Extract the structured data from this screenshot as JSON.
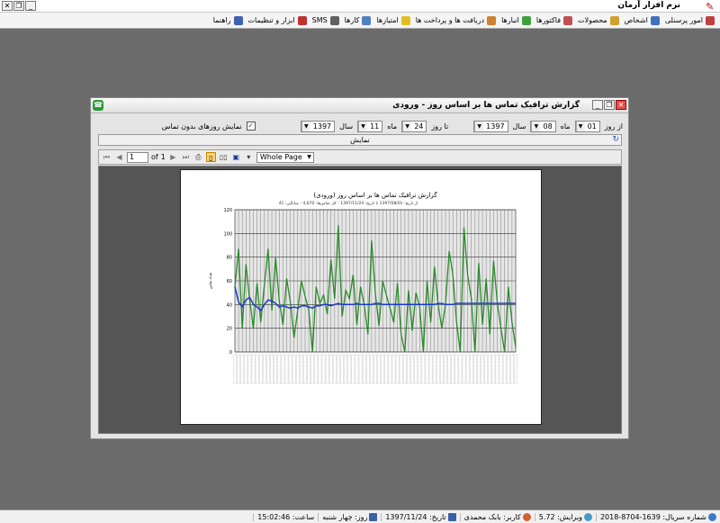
{
  "app": {
    "title": "نرم افزار آرمان"
  },
  "menu": [
    {
      "label": "امور پرسنلی",
      "icon": "personnel-icon",
      "color": "#c04040"
    },
    {
      "label": "اشخاص",
      "icon": "persons-icon",
      "color": "#4070c0"
    },
    {
      "label": "محصولات",
      "icon": "products-icon",
      "color": "#d0a030"
    },
    {
      "label": "فاکتورها",
      "icon": "invoices-icon",
      "color": "#c05050"
    },
    {
      "label": "انبارها",
      "icon": "warehouse-icon",
      "color": "#40a040"
    },
    {
      "label": "دریافت ها و پرداخت ها",
      "icon": "payments-icon",
      "color": "#d08030"
    },
    {
      "label": "امتیازها",
      "icon": "points-icon",
      "color": "#e0c020"
    },
    {
      "label": "کارها",
      "icon": "tasks-icon",
      "color": "#5080c0"
    },
    {
      "label": "SMS",
      "icon": "sms-icon",
      "color": "#606060"
    },
    {
      "label": "ابزار و تنظیمات",
      "icon": "tools-icon",
      "color": "#c03030"
    },
    {
      "label": "راهنما",
      "icon": "help-icon",
      "color": "#4060b0"
    }
  ],
  "window": {
    "title": "گزارش ترافیک تماس ها بر اساس روز - ورودی",
    "filters": {
      "from_label": "از روز",
      "from_day": "01",
      "month_label": "ماه",
      "from_month": "08",
      "year_label": "سال",
      "from_year": "1397",
      "to_label": "تا روز",
      "to_day": "24",
      "to_month": "11",
      "to_year": "1397",
      "show_empty_days_label": "نمایش روزهای بدون تماس",
      "show_empty_days_checked": "✓"
    },
    "show_button": "نمایش",
    "toolbar": {
      "page_value": "1",
      "of_label": "of",
      "total_pages": "1",
      "zoom": "Whole Page"
    }
  },
  "chart_data": {
    "type": "line",
    "title": "گزارش ترافیک تماس ها بر اساس روز (ورودی)",
    "subtitle": "از تاریخ: 1397/08/01 تا تاریخ: 1397/11/24 - کل تماس‌ها: 4,670 - میانگین: 41",
    "ylabel": "تعداد تماس",
    "ylim": [
      0,
      120
    ],
    "yticks": [
      0,
      20,
      40,
      60,
      80,
      100,
      120
    ],
    "grid": true,
    "series": [
      {
        "color": "#2a8a2a",
        "values": [
          55,
          87,
          20,
          74,
          44,
          20,
          58,
          25,
          57,
          87,
          35,
          80,
          43,
          23,
          62,
          42,
          12,
          35,
          60,
          47,
          35,
          0,
          55,
          41,
          48,
          32,
          78,
          45,
          107,
          30,
          52,
          45,
          65,
          23,
          55,
          40,
          15,
          94,
          50,
          22,
          60,
          48,
          37,
          25,
          58,
          15,
          0,
          52,
          18,
          50,
          38,
          0,
          60,
          25,
          72,
          40,
          20,
          40,
          85,
          65,
          25,
          0,
          105,
          65,
          45,
          0,
          75,
          23,
          62,
          15,
          77,
          42,
          20,
          0,
          55,
          25,
          4
        ]
      },
      {
        "color": "#1a3acc",
        "values": [
          55,
          42,
          38,
          44,
          46,
          40,
          38,
          35,
          40,
          44,
          43,
          41,
          38,
          39,
          38,
          37,
          38,
          37,
          39,
          39,
          38,
          37,
          39,
          39,
          40,
          40,
          39,
          40,
          41,
          40,
          40,
          40,
          40,
          41,
          40,
          40,
          40,
          40,
          41,
          41,
          40,
          40,
          40,
          40,
          40,
          40,
          40,
          40,
          40,
          40,
          40,
          40,
          40,
          40,
          40,
          41,
          41,
          40,
          40,
          40,
          41,
          41,
          41,
          41,
          41,
          41,
          41,
          41,
          41,
          41,
          41,
          41,
          41,
          41,
          41,
          41,
          41
        ]
      }
    ]
  },
  "status": {
    "serial": "شماره سریال: 1639-8704-2018",
    "version": "ویرایش: 5.72",
    "user": "کاربر: بابک محمدی",
    "date": "تاریخ: 1397/11/24",
    "weekday": "روز: چهار شنبه",
    "time": "ساعت: 15:02:46"
  }
}
